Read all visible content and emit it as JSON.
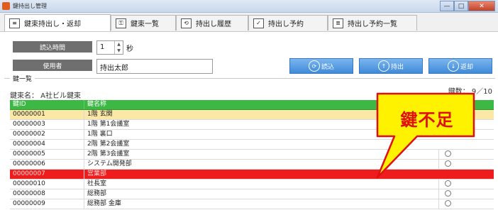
{
  "window": {
    "title": "鍵持出し管理",
    "min_glyph": "—",
    "max_glyph": "□",
    "close_glyph": "✕"
  },
  "tabs": [
    {
      "label": "鍵束持出し・返却",
      "icon": "keybox-icon",
      "glyph": "≡"
    },
    {
      "label": "鍵束一覧",
      "icon": "key-icon",
      "glyph": "⚿"
    },
    {
      "label": "持出し履歴",
      "icon": "history-icon",
      "glyph": "⟲"
    },
    {
      "label": "持出し予約",
      "icon": "checkbox-icon",
      "glyph": "✓"
    },
    {
      "label": "持出し予約一覧",
      "icon": "list-icon",
      "glyph": "≣"
    }
  ],
  "form": {
    "read_time_label": "読込時間",
    "read_time_value": "1",
    "read_time_unit": "秒",
    "user_label": "使用者",
    "user_value": "持出太郎"
  },
  "actions": {
    "read_label": "読込",
    "checkout_label": "持出",
    "return_label": "返却"
  },
  "key_list": {
    "group_title": "鍵一覧",
    "key_name": "鍵束名：  A社ビル鍵束",
    "key_count": "鍵数：  9／10",
    "columns": [
      "鍵ID",
      "鍵名称",
      ""
    ],
    "rows": [
      {
        "id": "00000001",
        "name": "1階 玄関",
        "state": "selected"
      },
      {
        "id": "00000003",
        "name": "1階 第1会議室",
        "state": "normal"
      },
      {
        "id": "00000002",
        "name": "1階 裏口",
        "state": "normal"
      },
      {
        "id": "00000004",
        "name": "2階 第2会議室",
        "state": "normal"
      },
      {
        "id": "00000005",
        "name": "2階 第3会議室",
        "state": "normal"
      },
      {
        "id": "00000006",
        "name": "システム開発部",
        "state": "normal"
      },
      {
        "id": "00000007",
        "name": "営業部",
        "state": "missing"
      },
      {
        "id": "00000010",
        "name": "社長室",
        "state": "normal"
      },
      {
        "id": "00000008",
        "name": "総務部",
        "state": "normal"
      },
      {
        "id": "00000009",
        "name": "総務部  金庫",
        "state": "normal"
      }
    ]
  },
  "callout": {
    "text": "鍵不足",
    "fill": "#fff200",
    "text_color": "#e01010"
  },
  "colors": {
    "header_green": "#3db844",
    "selected_row": "#fbe7a6",
    "missing_row": "#ee1c1c",
    "button_blue": "#4f95de"
  }
}
